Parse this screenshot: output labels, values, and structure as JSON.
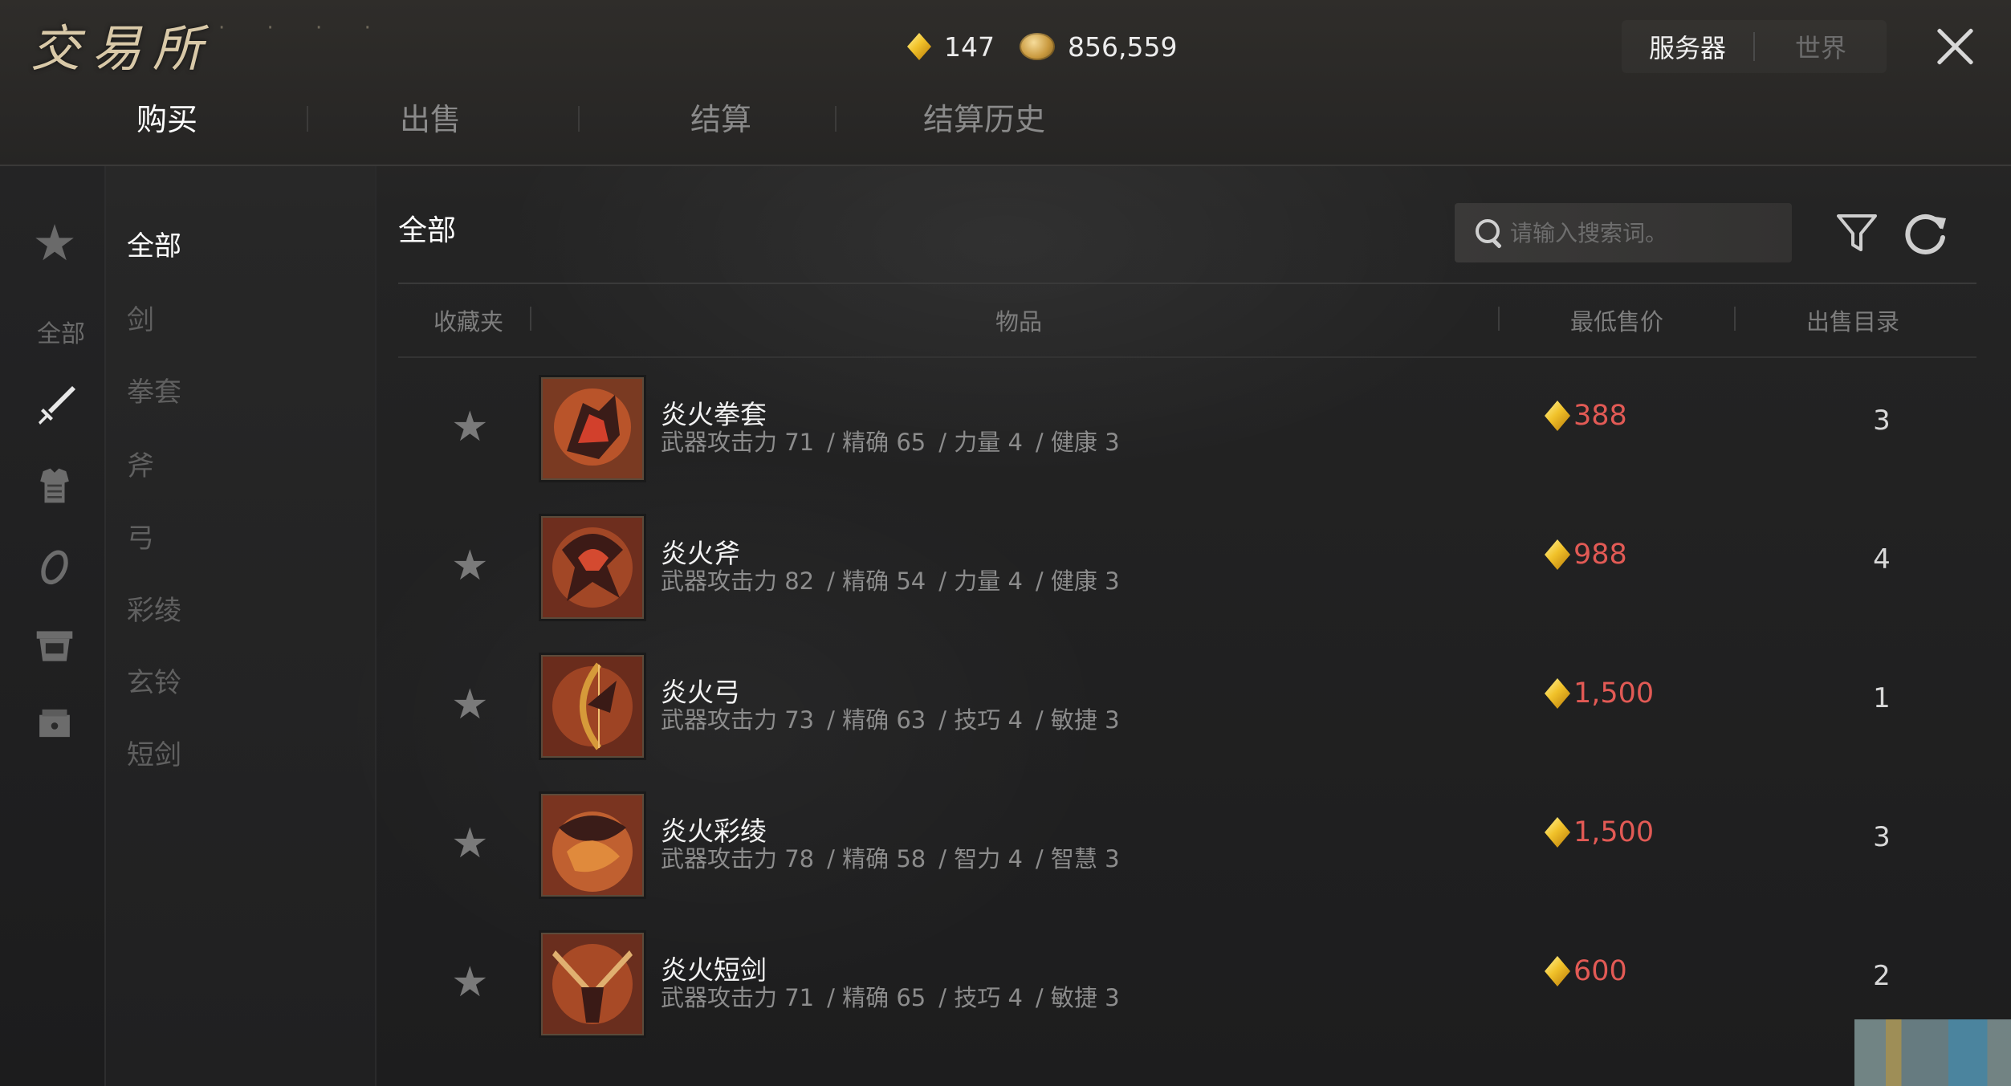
{
  "window": {
    "title": "交易所",
    "server_tabs": [
      "服务器",
      "世界"
    ]
  },
  "currency": {
    "gems": "147",
    "coins": "856,559"
  },
  "main_tabs": [
    "购买",
    "出售",
    "结算",
    "结算历史"
  ],
  "sidebar": {
    "icons": [
      "star-icon",
      "sword-icon",
      "armor-icon",
      "ring-icon",
      "chest-icon",
      "box-icon"
    ],
    "all_label": "全部"
  },
  "subcategories": [
    "全部",
    "剑",
    "拳套",
    "斧",
    "弓",
    "彩绫",
    "玄铃",
    "短剑"
  ],
  "content": {
    "section_title": "全部",
    "search_placeholder": "请输入搜索词。"
  },
  "table": {
    "headers": [
      "收藏夹",
      "物品",
      "最低售价",
      "出售目录"
    ],
    "rows": [
      {
        "name": "炎火拳套",
        "stats": [
          "武器攻击力 71",
          "/ 精确 65",
          "/ 力量 4",
          "/ 健康 3"
        ],
        "price": "388",
        "count": "3"
      },
      {
        "name": "炎火斧",
        "stats": [
          "武器攻击力 82",
          "/ 精确 54",
          "/ 力量 4",
          "/ 健康 3"
        ],
        "price": "988",
        "count": "4"
      },
      {
        "name": "炎火弓",
        "stats": [
          "武器攻击力 73",
          "/ 精确 63",
          "/ 技巧 4",
          "/ 敏捷 3"
        ],
        "price": "1,500",
        "count": "1"
      },
      {
        "name": "炎火彩绫",
        "stats": [
          "武器攻击力 78",
          "/ 精确 58",
          "/ 智力 4",
          "/ 智慧 3"
        ],
        "price": "1,500",
        "count": "3"
      },
      {
        "name": "炎火短剑",
        "stats": [
          "武器攻击力 71",
          "/ 精确 65",
          "/ 技巧 4",
          "/ 敏捷 3"
        ],
        "price": "600",
        "count": "2"
      }
    ]
  },
  "colors": {
    "price_red": "#e25a55",
    "gem_gold": "#f1c22a",
    "active_text": "#ffffff",
    "inactive_text": "#606060"
  }
}
